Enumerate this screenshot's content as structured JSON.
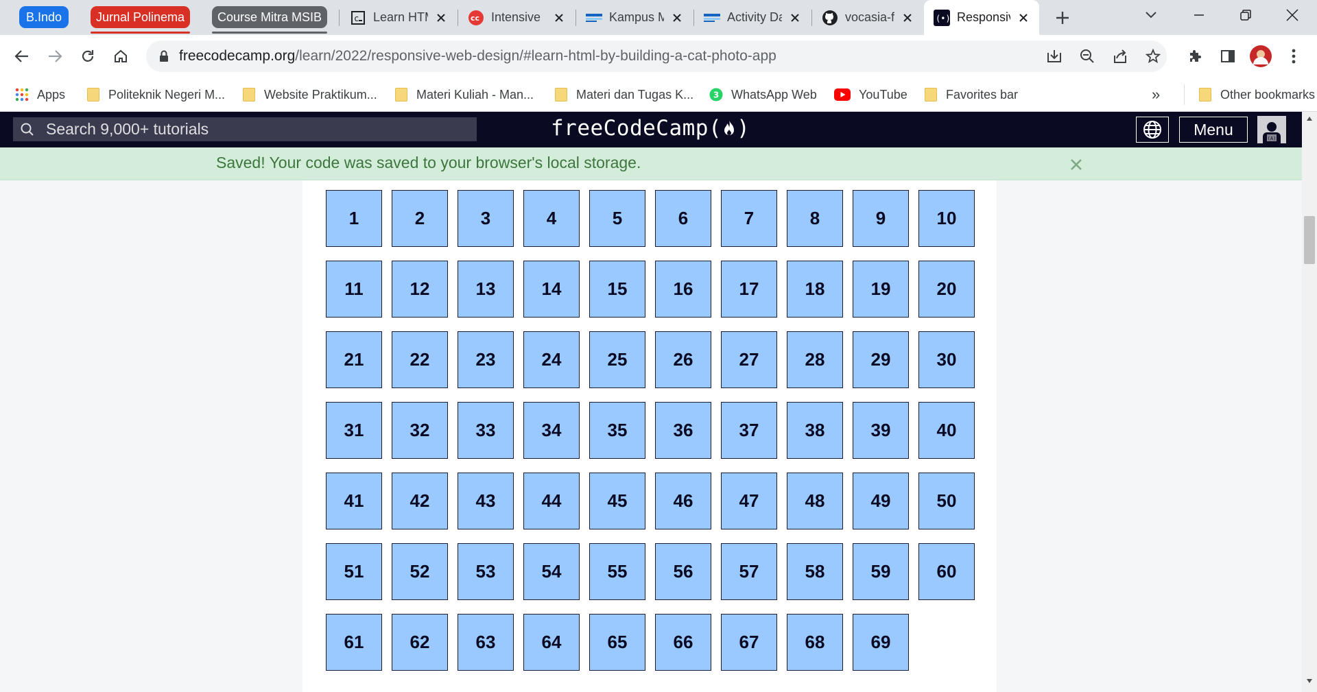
{
  "tab_groups": [
    {
      "label": "B.Indo",
      "color": "#1a73e8"
    },
    {
      "label": "Jurnal Polinema",
      "color": "#d93025"
    },
    {
      "label": "Course Mitra MSIB",
      "color": "#5f6368"
    }
  ],
  "tabs": [
    {
      "title": "Learn HTML",
      "icon": "codecademy-icon"
    },
    {
      "title": "Intensive",
      "icon": "cc-icon"
    },
    {
      "title": "Kampus Merdeka",
      "icon": "kampus-merdeka-icon"
    },
    {
      "title": "Activity Daily",
      "icon": "kampus-merdeka-icon"
    },
    {
      "title": "vocasia-fullstack",
      "icon": "github-icon"
    },
    {
      "title": "Responsive Web Design",
      "icon": "freecodecamp-icon",
      "active": true
    }
  ],
  "address_bar": {
    "domain": "freecodecamp.org",
    "path": "/learn/2022/responsive-web-design/#learn-html-by-building-a-cat-photo-app"
  },
  "bookmarks": {
    "apps": "Apps",
    "items": [
      "Politeknik Negeri M...",
      "Website Praktikum...",
      "Materi Kuliah - Man...",
      "Materi dan Tugas K...",
      "WhatsApp Web",
      "YouTube",
      "Favorites bar"
    ],
    "whatsapp_badge": "3",
    "overflow": "»",
    "other": "Other bookmarks"
  },
  "fcc_nav": {
    "search_placeholder": "Search 9,000+ tutorials",
    "logo_text": "freeCodeCamp(",
    "logo_close": ")",
    "menu_label": "Menu"
  },
  "alert": {
    "message": "Saved! Your code was saved to your browser's local storage."
  },
  "grid_numbers": [
    "1",
    "2",
    "3",
    "4",
    "5",
    "6",
    "7",
    "8",
    "9",
    "10",
    "11",
    "12",
    "13",
    "14",
    "15",
    "16",
    "17",
    "18",
    "19",
    "20",
    "21",
    "22",
    "23",
    "24",
    "25",
    "26",
    "27",
    "28",
    "29",
    "30",
    "31",
    "32",
    "33",
    "34",
    "35",
    "36",
    "37",
    "38",
    "39",
    "40",
    "41",
    "42",
    "43",
    "44",
    "45",
    "46",
    "47",
    "48",
    "49",
    "50",
    "51",
    "52",
    "53",
    "54",
    "55",
    "56",
    "57",
    "58",
    "59",
    "60",
    "61",
    "62",
    "63",
    "64",
    "65",
    "66",
    "67",
    "68",
    "69"
  ],
  "colors": {
    "cell_fill": "#99c9ff",
    "cell_border": "#1b1b32",
    "fcc_nav_bg": "#0a0a23",
    "alert_bg": "#d4edda",
    "alert_text": "#3c763d"
  }
}
